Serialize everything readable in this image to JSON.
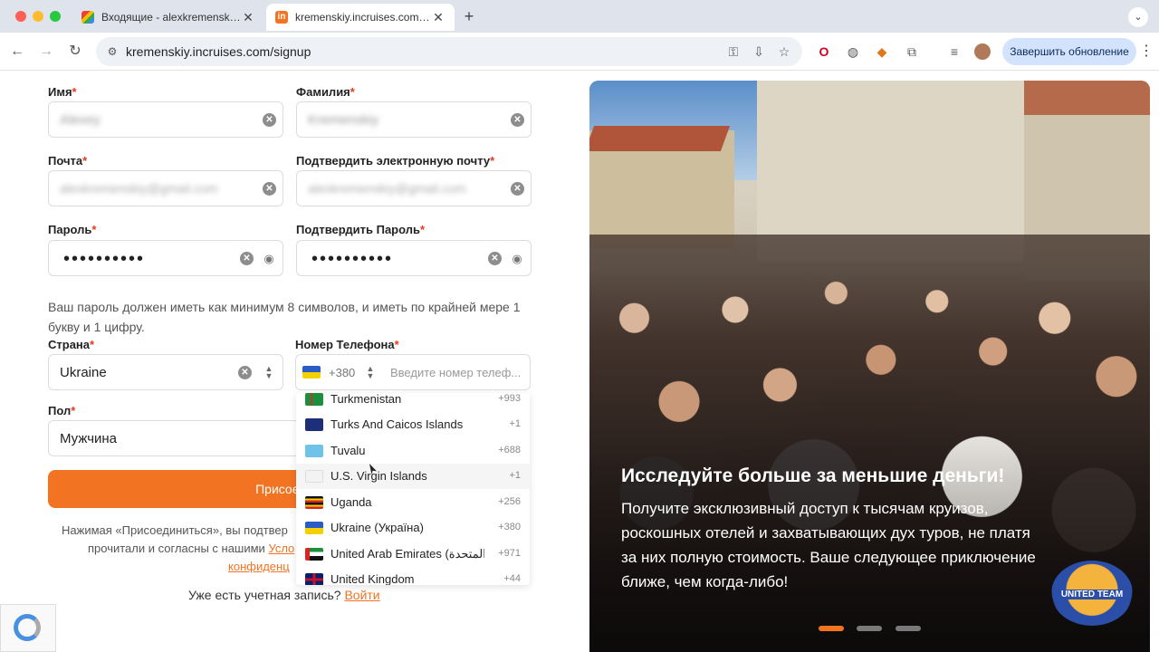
{
  "browser": {
    "tabs": [
      {
        "title": "Входящие - alexkremenskiy@",
        "favicon": "gmail-icon",
        "active": false
      },
      {
        "title": "kremenskiy.incruises.com/sig",
        "favicon": "incruises-icon",
        "active": true
      }
    ],
    "new_tab": "+",
    "url": "kremenskiy.incruises.com/signup",
    "update_button": "Завершить обновление"
  },
  "form": {
    "first_name": {
      "label": "Имя",
      "value": "Alexey"
    },
    "last_name": {
      "label": "Фамилия",
      "value": "Kremenskiy"
    },
    "email": {
      "label": "Почта",
      "value": "alexkremenskiy@gmail.com"
    },
    "confirm_email": {
      "label": "Подтвердить электронную почту",
      "value": "alexkremenskiy@gmail.com"
    },
    "password": {
      "label": "Пароль",
      "value": "••••••••••"
    },
    "confirm_password": {
      "label": "Подтвердить Пароль",
      "value": "••••••••••"
    },
    "password_hint": "Ваш пароль должен иметь как минимум 8 символов, и иметь по крайней мере 1 букву и 1 цифру.",
    "country": {
      "label": "Страна",
      "value": "Ukraine"
    },
    "phone": {
      "label": "Номер Телефона",
      "dial_code": "+380",
      "placeholder": "Введите номер телеф..."
    },
    "gender": {
      "label": "Пол",
      "value": "Мужчина"
    },
    "required_mark": "*",
    "join_button": "Присоедин",
    "terms_line1": "Нажимая «Присоединиться», вы подтвер",
    "terms_line2_prefix": "прочитали и согласны с нашими ",
    "terms_link1": "Усло",
    "terms_line3_link": "конфиденц",
    "have_account": "Уже есть учетная запись?",
    "login_link": "Войти"
  },
  "country_dropdown": {
    "items": [
      {
        "name": "Turkmenistan",
        "code": "+993",
        "flag": "tm"
      },
      {
        "name": "Turks And Caicos Islands",
        "code": "+1",
        "flag": "tc"
      },
      {
        "name": "Tuvalu",
        "code": "+688",
        "flag": "tv"
      },
      {
        "name": "U.S. Virgin Islands",
        "code": "+1",
        "flag": "vi",
        "hover": true
      },
      {
        "name": "Uganda",
        "code": "+256",
        "flag": "ug"
      },
      {
        "name": "Ukraine (Україна)",
        "code": "+380",
        "flag": "ua"
      },
      {
        "name": "United Arab Emirates (‫الإمارات العربية المتحدة‬‎)",
        "code": "+971",
        "flag": "ae"
      },
      {
        "name": "United Kingdom",
        "code": "+44",
        "flag": "gb"
      }
    ]
  },
  "hero": {
    "title": "Исследуйте больше за меньшие деньги!",
    "description": "Получите эксклюзивный доступ к тысячам круизов, роскошных отелей и захватывающих дух туров, не платя за них полную стоимость. Ваше следующее приключение ближе, чем когда-либо!",
    "badge": "UNITED TEAM",
    "slides": 3,
    "active_slide": 1
  },
  "colors": {
    "accent": "#f27321",
    "required": "#e5391f"
  }
}
